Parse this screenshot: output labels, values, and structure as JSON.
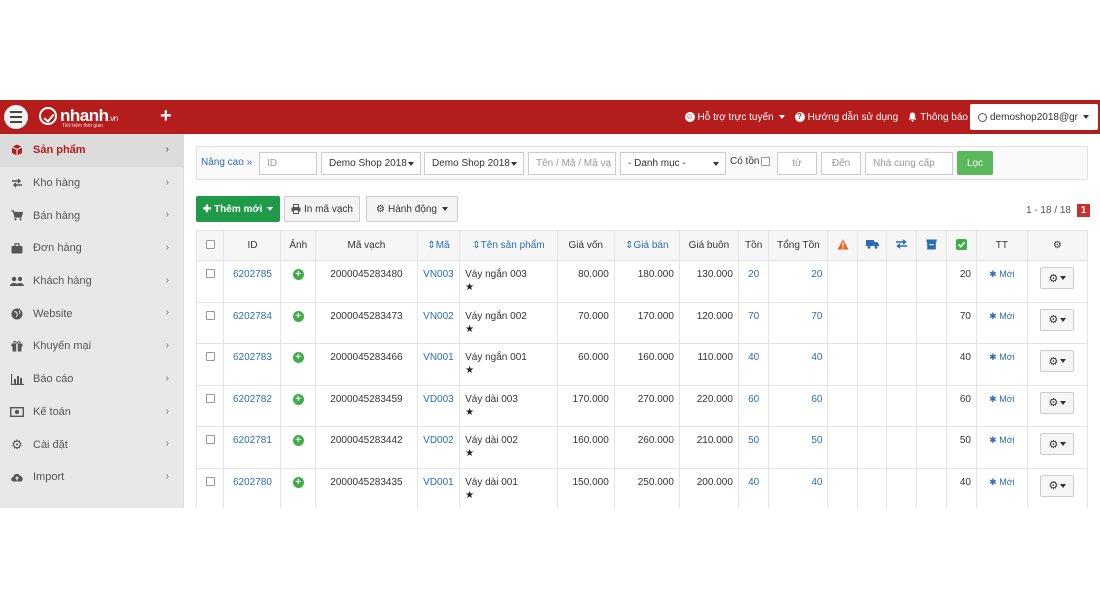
{
  "topbar": {
    "logo": "nhanh",
    "logo_suffix": ".vn",
    "logo_tagline": "Tiết kiệm thời gian",
    "support": "Hỗ trợ trực tuyến",
    "guide": "Hướng dẫn sử dụng",
    "notify": "Thông báo",
    "user": "demoshop2018@gr"
  },
  "sidebar": {
    "items": [
      {
        "label": "Sản phẩm",
        "icon": "cube-icon"
      },
      {
        "label": "Kho hàng",
        "icon": "exchange-icon"
      },
      {
        "label": "Bán hàng",
        "icon": "cart-icon"
      },
      {
        "label": "Đơn hàng",
        "icon": "briefcase-icon"
      },
      {
        "label": "Khách hàng",
        "icon": "users-icon"
      },
      {
        "label": "Website",
        "icon": "globe-icon"
      },
      {
        "label": "Khuyến mại",
        "icon": "gift-icon"
      },
      {
        "label": "Báo cáo",
        "icon": "bar-chart-icon"
      },
      {
        "label": "Kế toán",
        "icon": "money-icon"
      },
      {
        "label": "Cài đặt",
        "icon": "gear-icon"
      },
      {
        "label": "Import",
        "icon": "cloud-upload-icon"
      }
    ]
  },
  "filters": {
    "advanced": "Nâng cao",
    "id_placeholder": "ID",
    "shop1": "Demo Shop 2018",
    "shop2": "Demo Shop 2018",
    "name_placeholder": "Tên / Mã / Mã vạ",
    "category": "- Danh mục -",
    "in_stock": "Có tồn",
    "from_placeholder": "từ",
    "to_placeholder": "Đến",
    "supplier_placeholder": "Nhà cung cấp",
    "filter_button": "Lọc"
  },
  "actions": {
    "add": "Thêm mới",
    "barcode": "In mã vạch",
    "action": "Hành động"
  },
  "pagination": {
    "range": "1 - 18 / 18",
    "page": "1"
  },
  "table": {
    "headers": {
      "id": "ID",
      "image": "Ảnh",
      "barcode": "Mã vạch",
      "code": "Mã",
      "name": "Tên sản phẩm",
      "cost": "Giá vốn",
      "price": "Giá bán",
      "wholesale": "Giá buôn",
      "stock": "Tồn",
      "total_stock": "Tổng Tồn",
      "status": "TT"
    },
    "rows": [
      {
        "id": "6202785",
        "barcode": "2000045283480",
        "code": "VN003",
        "name": "Váy ngắn 003",
        "cost": "80.000",
        "price": "180.000",
        "wholesale": "130.000",
        "stock": "20",
        "total": "20",
        "last": "20",
        "status": "Mới"
      },
      {
        "id": "6202784",
        "barcode": "2000045283473",
        "code": "VN002",
        "name": "Váy ngắn 002",
        "cost": "70.000",
        "price": "170.000",
        "wholesale": "120.000",
        "stock": "70",
        "total": "70",
        "last": "70",
        "status": "Mới"
      },
      {
        "id": "6202783",
        "barcode": "2000045283466",
        "code": "VN001",
        "name": "Váy ngắn 001",
        "cost": "60.000",
        "price": "160.000",
        "wholesale": "110.000",
        "stock": "40",
        "total": "40",
        "last": "40",
        "status": "Mới"
      },
      {
        "id": "6202782",
        "barcode": "2000045283459",
        "code": "VD003",
        "name": "Váy dài 003",
        "cost": "170.000",
        "price": "270.000",
        "wholesale": "220.000",
        "stock": "60",
        "total": "60",
        "last": "60",
        "status": "Mới"
      },
      {
        "id": "6202781",
        "barcode": "2000045283442",
        "code": "VD002",
        "name": "Váy dài 002",
        "cost": "160.000",
        "price": "260.000",
        "wholesale": "210.000",
        "stock": "50",
        "total": "50",
        "last": "50",
        "status": "Mới"
      },
      {
        "id": "6202780",
        "barcode": "2000045283435",
        "code": "VD001",
        "name": "Váy dài 001",
        "cost": "150.000",
        "price": "250.000",
        "wholesale": "200.000",
        "stock": "40",
        "total": "40",
        "last": "40",
        "status": "Mới"
      }
    ]
  },
  "colors": {
    "brand_red": "#b51c1c",
    "green": "#1f9a48",
    "link": "#2a6db5"
  }
}
